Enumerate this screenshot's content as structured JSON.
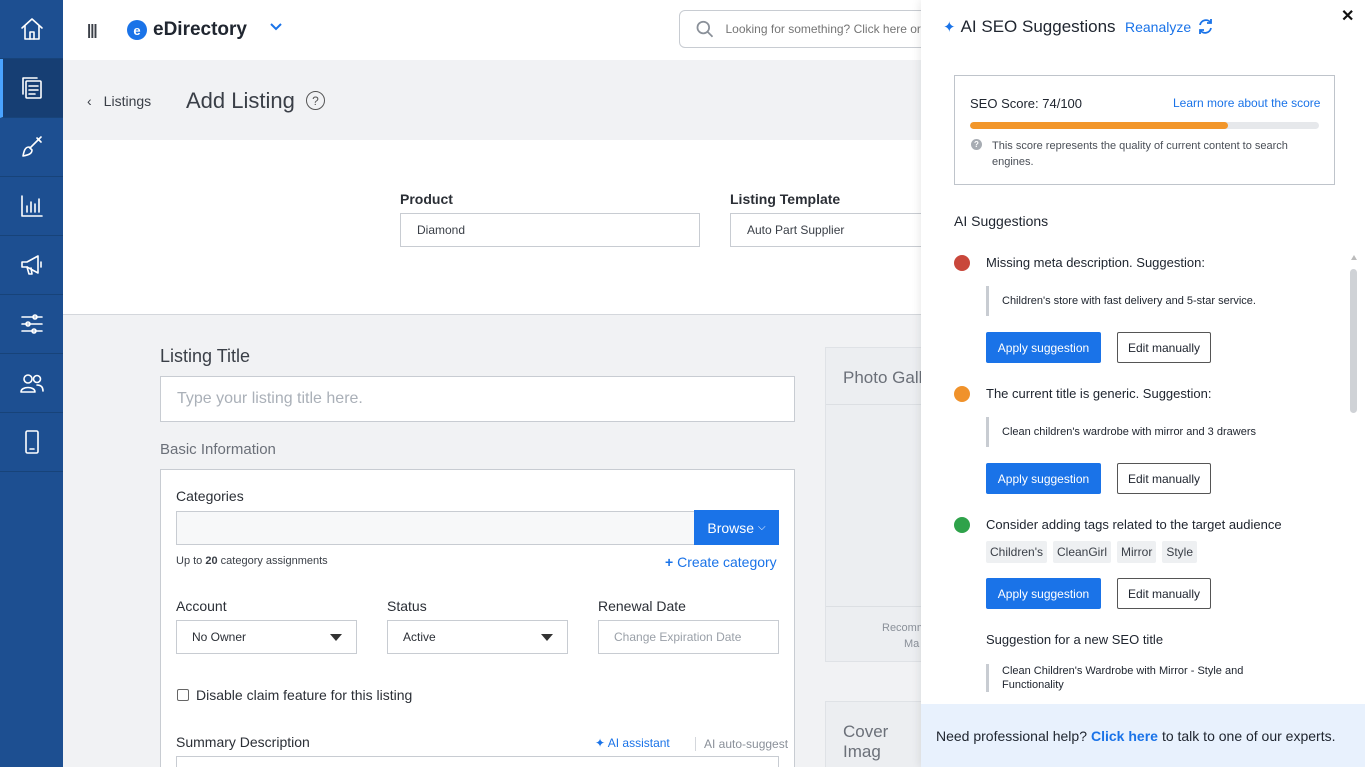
{
  "app": {
    "brand": "eDirectory",
    "brand_mark": "e"
  },
  "sidebar": {
    "items": [
      {
        "name": "home-icon"
      },
      {
        "name": "listings-icon",
        "active": true
      },
      {
        "name": "design-brush-icon"
      },
      {
        "name": "reports-chart-icon"
      },
      {
        "name": "promotion-megaphone-icon"
      },
      {
        "name": "settings-sliders-icon"
      },
      {
        "name": "users-icon"
      },
      {
        "name": "mobile-icon"
      }
    ]
  },
  "topbar": {
    "search_placeholder": "Looking for something? Click here or"
  },
  "header": {
    "back_label": "Listings",
    "title": "Add Listing",
    "help": "?"
  },
  "product": {
    "label": "Product",
    "value": "Diamond"
  },
  "template": {
    "label": "Listing Template",
    "value": "Auto Part Supplier"
  },
  "form": {
    "listing_title_label": "Listing Title",
    "listing_title_placeholder": "Type your listing title here.",
    "basic_info_label": "Basic Information",
    "categories_label": "Categories",
    "browse_label": "Browse",
    "up_to_prefix": "Up to",
    "up_to_count": "20",
    "up_to_suffix": "category assignments",
    "create_category_label": "Create category",
    "account_label": "Account",
    "account_value": "No Owner",
    "status_label": "Status",
    "status_value": "Active",
    "renewal_label": "Renewal Date",
    "renewal_placeholder": "Change Expiration Date",
    "disable_claim_label": "Disable claim feature for this listing",
    "summary_label": "Summary Description",
    "ai_assistant_label": "AI assistant",
    "ai_autosuggest_label": "AI auto-suggest"
  },
  "gallery": {
    "title": "Photo Galle",
    "rec_line1": "Recomm",
    "rec_line2": "Ma"
  },
  "cover": {
    "title": "Cover Imag"
  },
  "seo_panel": {
    "title": "AI SEO Suggestions",
    "reanalyze_label": "Reanalyze",
    "score_label": "SEO Score: 74/100",
    "score_value": 74,
    "score_max": 100,
    "score_link": "Learn more about the score",
    "score_desc": "This score represents the quality of current content to search engines.",
    "suggestions_heading": "AI Suggestions",
    "suggestions": [
      {
        "status": "#c9473b",
        "text": "Missing meta description. Suggestion:",
        "quote": "Children's store with fast delivery and 5-star service.",
        "apply": "Apply suggestion",
        "edit": "Edit manually"
      },
      {
        "status": "#f0922b",
        "text": "The current title is generic. Suggestion:",
        "quote": "Clean children's wardrobe with mirror and 3 drawers",
        "apply": "Apply suggestion",
        "edit": "Edit manually"
      },
      {
        "status": "#2ea24a",
        "text": "Consider adding tags related to the target audience",
        "tags": [
          "Children's",
          "CleanGirl",
          "Mirror",
          "Style"
        ],
        "apply": "Apply suggestion",
        "edit": "Edit manually"
      },
      {
        "text": "Suggestion for a new SEO title",
        "quote": "Clean Children's Wardrobe with Mirror - Style and Functionality"
      }
    ],
    "footer_prefix": "Need professional help?",
    "footer_link": "Click here",
    "footer_suffix": "to talk to one of our experts."
  },
  "colors": {
    "sidebar": "#1d4f91",
    "accent": "#1a73e8",
    "score_bar": "#f2962a"
  }
}
